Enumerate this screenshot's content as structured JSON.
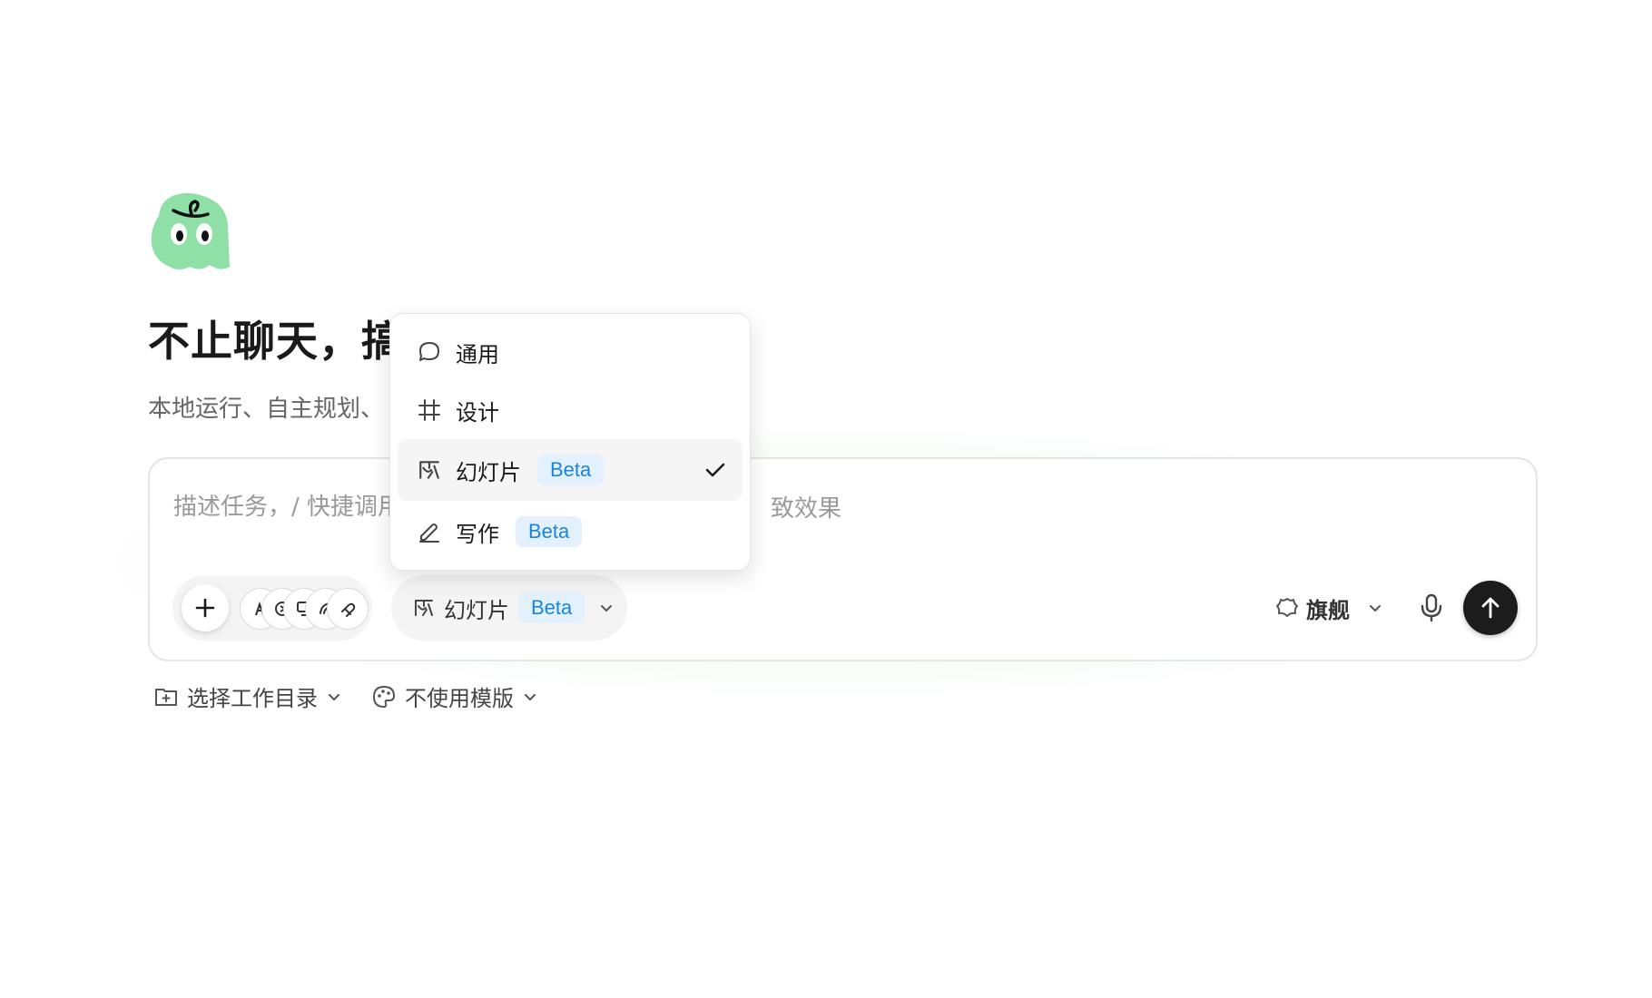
{
  "hero": {
    "headline": "不止聊天，搞",
    "subline": "本地运行、自主规划、"
  },
  "composer": {
    "placeholder": "描述任务，/ 快捷调用",
    "placeholder_tail": "致效果",
    "mode_label": "幻灯片",
    "mode_badge": "Beta",
    "model_label": "旗舰"
  },
  "below": {
    "workdir_label": "选择工作目录",
    "template_label": "不使用模版"
  },
  "mode_menu": {
    "items": [
      {
        "label": "通用",
        "icon": "chat-bubble-icon",
        "badge": ""
      },
      {
        "label": "设计",
        "icon": "frame-icon",
        "badge": ""
      },
      {
        "label": "幻灯片",
        "icon": "slides-icon",
        "badge": "Beta",
        "selected": true
      },
      {
        "label": "写作",
        "icon": "pen-icon",
        "badge": "Beta"
      }
    ]
  },
  "colors": {
    "logo_green": "#8fe0a6",
    "beta_bg": "#e2f1fd",
    "beta_text": "#1a84e3",
    "send_bg": "#1c1c1c"
  }
}
